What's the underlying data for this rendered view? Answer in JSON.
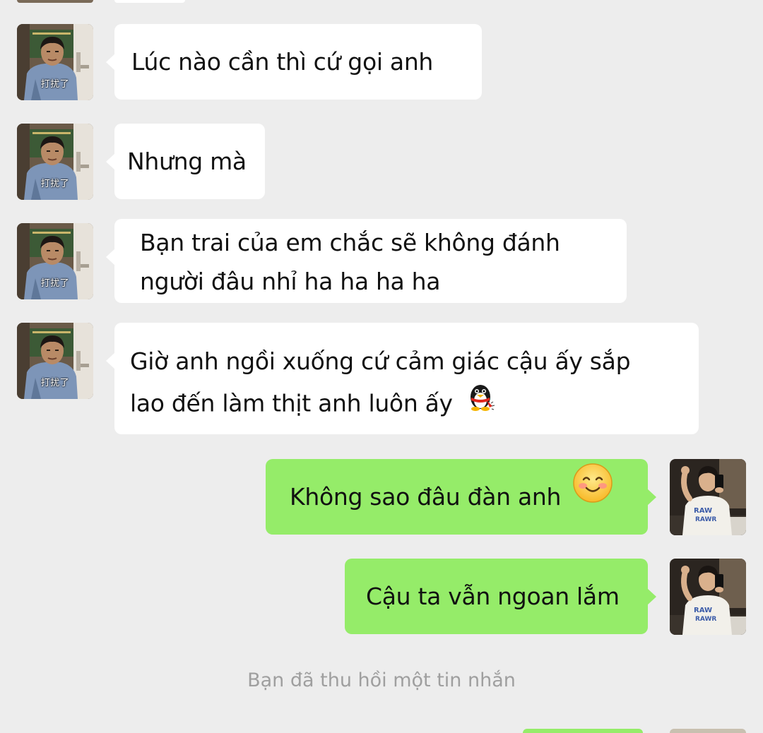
{
  "colors": {
    "background": "#ededed",
    "incoming_bubble": "#ffffff",
    "outgoing_bubble": "#95ec69",
    "system_text": "#9f9f9f"
  },
  "contact": {
    "avatar_icon": "boy-avatar",
    "avatar_stamp": "打扰了"
  },
  "me": {
    "avatar_icon": "selfie-avatar"
  },
  "messages": [
    {
      "side": "in",
      "text": "Lúc nào cần thì cứ gọi anh"
    },
    {
      "side": "in",
      "text": "Nhưng mà"
    },
    {
      "side": "in",
      "line1": "Bạn trai của em chắc sẽ không đánh",
      "line2": "người đâu nhỉ ha ha ha ha"
    },
    {
      "side": "in",
      "line1": "Giờ anh ngồi xuống cứ cảm giác cậu ấy sắp",
      "line2": "lao đến làm thịt anh luôn ấy",
      "emoji": "penguin-emoji"
    },
    {
      "side": "out",
      "text": "Không sao đâu đàn anh",
      "emoji": "smile-emoji"
    },
    {
      "side": "out",
      "text": "Cậu ta vẫn ngoan lắm"
    }
  ],
  "system": {
    "recall_notice": "Bạn đã thu hồi một tin nhắn"
  }
}
